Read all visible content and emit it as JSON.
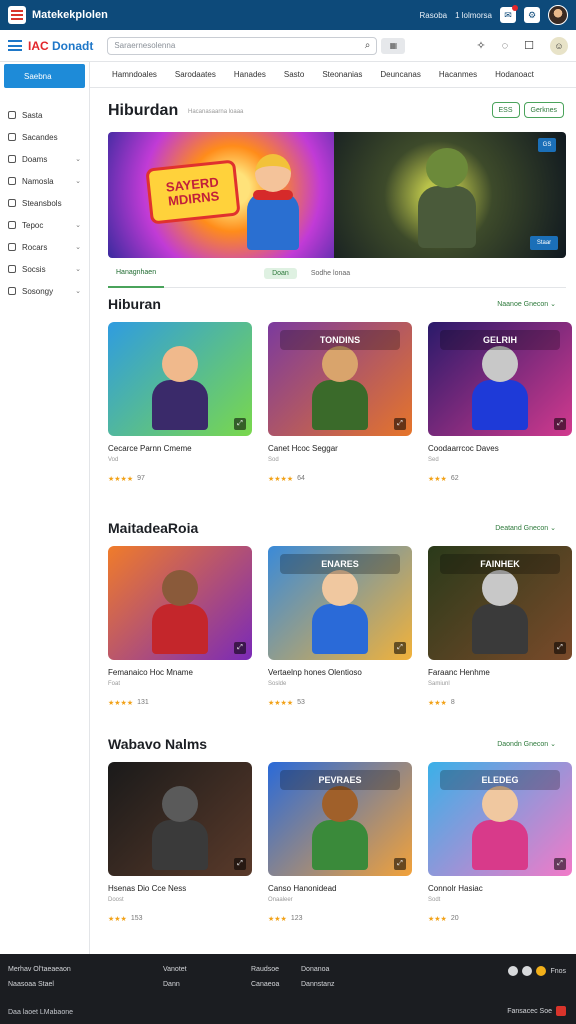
{
  "app": {
    "title": "Matekekplolen"
  },
  "topbar": {
    "links": [
      "Rasoba",
      "1 lolmorsa"
    ]
  },
  "header": {
    "brand": "Donadt",
    "brand_prefix": "IAC",
    "search_placeholder": "Saraernesolenna"
  },
  "sidebar": {
    "active": "Saebna",
    "items": [
      {
        "label": "Sasta",
        "chevron": false
      },
      {
        "label": "Sacandes",
        "chevron": false
      },
      {
        "label": "Doams",
        "chevron": true
      },
      {
        "label": "Namosla",
        "chevron": true
      },
      {
        "label": "Steansbols",
        "chevron": false
      },
      {
        "label": "Tepoc",
        "chevron": true
      },
      {
        "label": "Rocars",
        "chevron": true
      },
      {
        "label": "Socsis",
        "chevron": true
      },
      {
        "label": "Sosongy",
        "chevron": true
      }
    ]
  },
  "nav": {
    "tabs": [
      "Hamndoales",
      "Sarodaates",
      "Hanades",
      "Sasto",
      "Steonanias",
      "Deuncanas",
      "Hacanmes",
      "Hodanoact"
    ]
  },
  "hero": {
    "title": "Hiburdan",
    "subtitle": "Hacanasaarna loaaa",
    "btn1": "ESS",
    "btn2": "Gerknes",
    "banner_text_1": "SAYERD",
    "banner_text_2": "MDIRNS",
    "tag": "GS",
    "play_label": "Staar",
    "tabs": [
      "Hanagnhaen",
      "Doan",
      "Sodhe lonaa"
    ]
  },
  "sections": [
    {
      "title": "Hiburan",
      "more": "Naanoe Gnecon",
      "cards": [
        {
          "name": "Cecarce Parnn Cmeme",
          "meta": "Vod",
          "rating": "★★★★",
          "count": "97",
          "label": "",
          "c1": "#2f9ce0",
          "c2": "#7ad84c",
          "h": "#f0b98c",
          "b": "#3a2a6a"
        },
        {
          "name": "Canet Hcoc Seggar",
          "meta": "Sod",
          "rating": "★★★★",
          "count": "64",
          "label": "TONDINS",
          "c1": "#7b3a9e",
          "c2": "#e6752a",
          "h": "#d9a46c",
          "b": "#3a6a2a"
        },
        {
          "name": "Coodaarrcoc Daves",
          "meta": "Sed",
          "rating": "★★★",
          "count": "62",
          "label": "GELRIH",
          "c1": "#2a1a6a",
          "c2": "#d23a8e",
          "h": "#c8c8c8",
          "b": "#1e3ad8"
        }
      ]
    },
    {
      "title": "MaitadeaRoia",
      "more": "Deatand Gnecon",
      "cards": [
        {
          "name": "Femanaico Hoc Mname",
          "meta": "Foat",
          "rating": "★★★★",
          "count": "131",
          "label": "",
          "c1": "#f07c2a",
          "c2": "#7a2ab8",
          "h": "#8a5a3a",
          "b": "#c4262b"
        },
        {
          "name": "Vertaelnp hones Olentioso",
          "meta": "Soslde",
          "rating": "★★★★",
          "count": "53",
          "label": "ENARES",
          "c1": "#3a8ad8",
          "c2": "#f2b23a",
          "h": "#f0c8a0",
          "b": "#2a6ad8"
        },
        {
          "name": "Faraanc Henhme",
          "meta": "Samiunl",
          "rating": "★★★",
          "count": "8",
          "label": "FAINHEK",
          "c1": "#2a3a1a",
          "c2": "#7a4a2a",
          "h": "#c8c8c8",
          "b": "#3a3a3a"
        }
      ]
    },
    {
      "title": "Wabavo Nalms",
      "more": "Daondn Gnecon",
      "cards": [
        {
          "name": "Hsenas Dio Cce Ness",
          "meta": "Doost",
          "rating": "★★★",
          "count": "153",
          "label": "",
          "c1": "#1a1a1a",
          "c2": "#5a3a2a",
          "h": "#5a5a5a",
          "b": "#3a3a3a"
        },
        {
          "name": "Canso Hanonidead",
          "meta": "Onaaleer",
          "rating": "★★★",
          "count": "123",
          "label": "PEVRAES",
          "c1": "#2a6ad8",
          "c2": "#f2a23a",
          "h": "#a0602a",
          "b": "#3a8a3a"
        },
        {
          "name": "Connolr Hasiac",
          "meta": "Sodt",
          "rating": "★★★",
          "count": "20",
          "label": "ELEDEG",
          "c1": "#3ab0e8",
          "c2": "#f27ac8",
          "h": "#f0c8a0",
          "b": "#d83a8a"
        }
      ]
    }
  ],
  "footer": {
    "cols": [
      [
        "Merhav Ol'taeaeaon",
        "Naasoaa Stael"
      ],
      [
        "Vanotet",
        "Dann"
      ],
      [
        "Raudsoe",
        "Canaeoa"
      ],
      [
        "Donanoa",
        "Dannstanz"
      ]
    ],
    "social_label": "Fnos",
    "copyright": "Daa laoet LMabaone",
    "brand_right": "Fansacec Soe"
  }
}
